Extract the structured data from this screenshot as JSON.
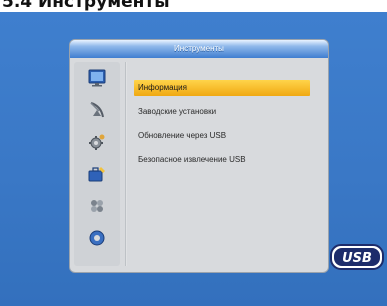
{
  "page_heading": "5.4 Инструменты",
  "menu": {
    "title": "Инструменты",
    "items": [
      {
        "label": "Информация",
        "selected": true
      },
      {
        "label": "Заводские установки",
        "selected": false
      },
      {
        "label": "Обновление через USB",
        "selected": false
      },
      {
        "label": "Безопасное извлечение USB",
        "selected": false
      }
    ],
    "side_icons": [
      "tv-icon",
      "satellite-dish-icon",
      "gear-icon",
      "toolbox-icon",
      "game-icon",
      "record-icon"
    ]
  },
  "usb_logo": "USB",
  "colors": {
    "screen_bg": "#3a78c6",
    "window_bg": "#d8dadd",
    "header": "#3f7ed0",
    "selection": "#f5b820"
  }
}
